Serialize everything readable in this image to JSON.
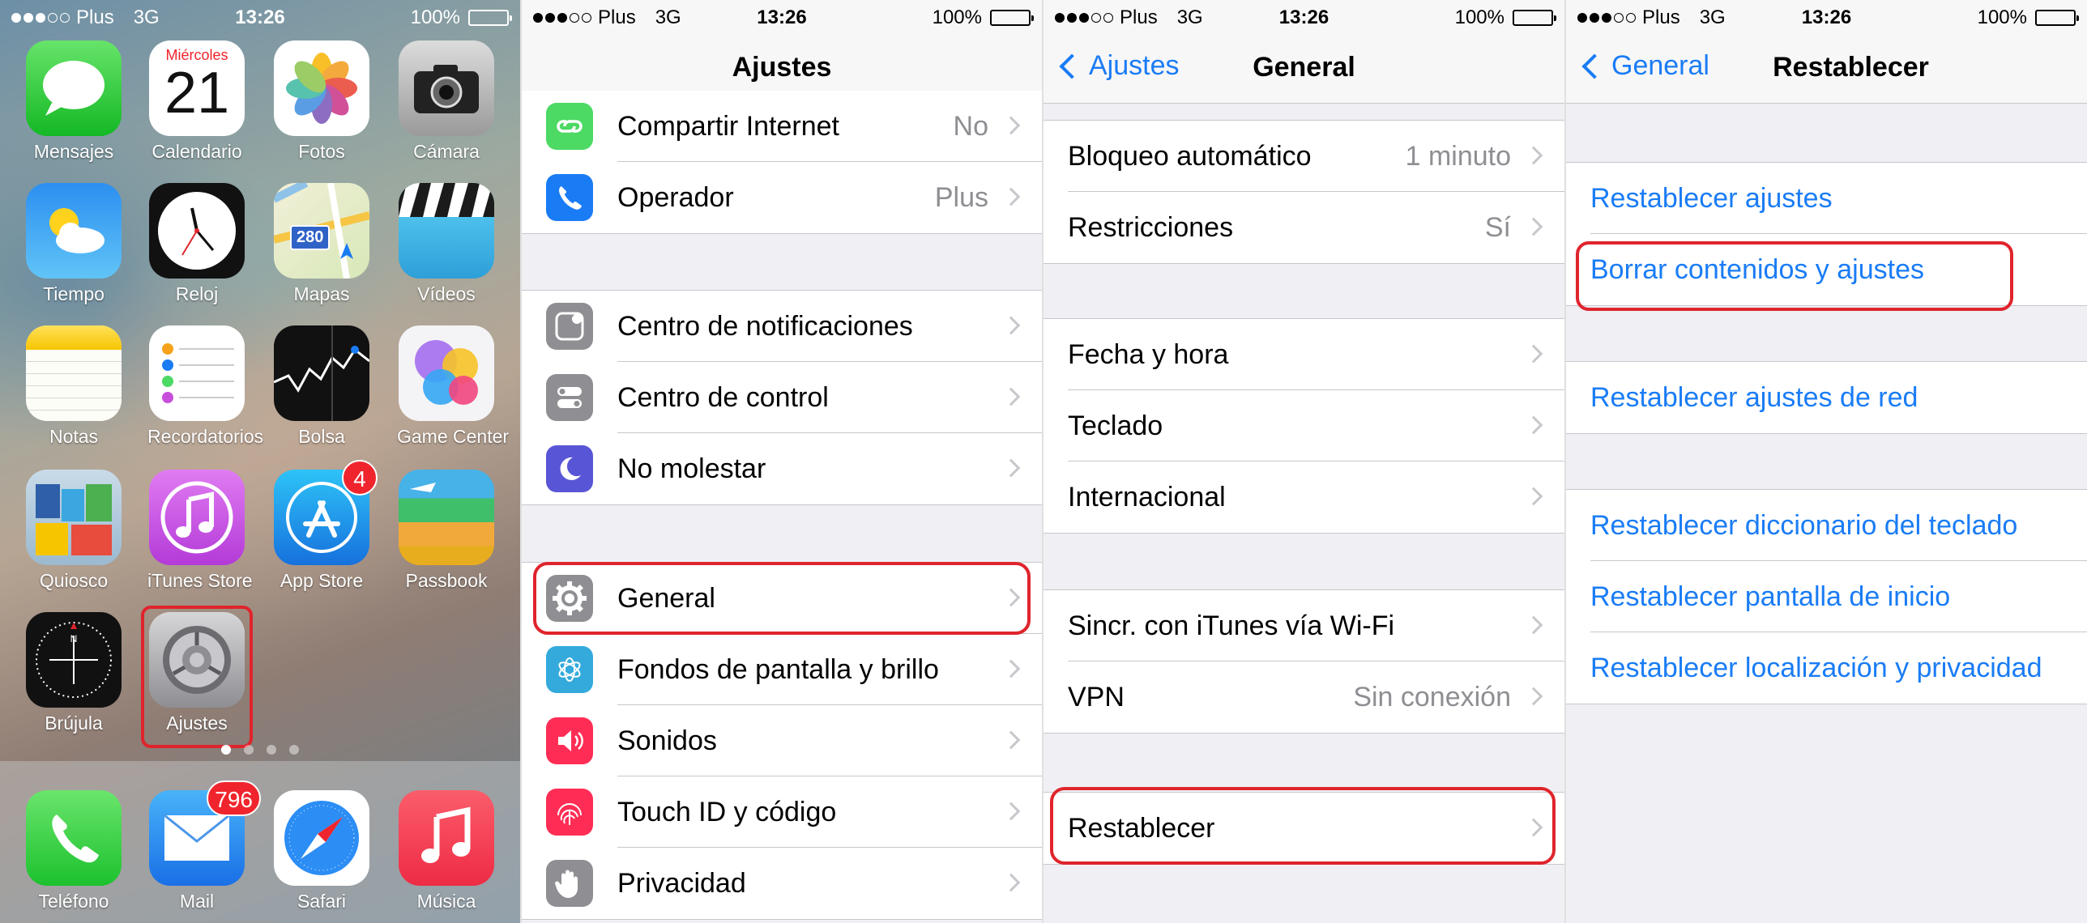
{
  "status": {
    "carrier": "Plus",
    "network": "3G",
    "time": "13:26",
    "battery": "100%"
  },
  "home": {
    "calendar": {
      "weekday": "Miércoles",
      "day": "21"
    },
    "apps": [
      {
        "label": "Mensajes",
        "icon": "messages-icon"
      },
      {
        "label": "Calendario",
        "icon": "calendar-icon"
      },
      {
        "label": "Fotos",
        "icon": "photos-icon"
      },
      {
        "label": "Cámara",
        "icon": "camera-icon"
      },
      {
        "label": "Tiempo",
        "icon": "weather-icon"
      },
      {
        "label": "Reloj",
        "icon": "clock-icon"
      },
      {
        "label": "Mapas",
        "icon": "maps-icon",
        "shield": "280"
      },
      {
        "label": "Vídeos",
        "icon": "videos-icon"
      },
      {
        "label": "Notas",
        "icon": "notes-icon"
      },
      {
        "label": "Recordatorios",
        "icon": "reminders-icon"
      },
      {
        "label": "Bolsa",
        "icon": "stocks-icon"
      },
      {
        "label": "Game Center",
        "icon": "game-center-icon"
      },
      {
        "label": "Quiosco",
        "icon": "newsstand-icon"
      },
      {
        "label": "iTunes Store",
        "icon": "itunes-store-icon"
      },
      {
        "label": "App Store",
        "icon": "app-store-icon",
        "badge": "4"
      },
      {
        "label": "Passbook",
        "icon": "passbook-icon"
      },
      {
        "label": "Brújula",
        "icon": "compass-icon"
      },
      {
        "label": "Ajustes",
        "icon": "settings-icon"
      }
    ],
    "dock": [
      {
        "label": "Teléfono",
        "icon": "phone-icon"
      },
      {
        "label": "Mail",
        "icon": "mail-icon",
        "badge": "796"
      },
      {
        "label": "Safari",
        "icon": "safari-icon"
      },
      {
        "label": "Música",
        "icon": "music-icon"
      }
    ]
  },
  "ajustes": {
    "title": "Ajustes",
    "groups": [
      [
        {
          "label": "Compartir Internet",
          "value": "No",
          "icon": "hotspot-icon"
        },
        {
          "label": "Operador",
          "value": "Plus",
          "icon": "carrier-phone-icon"
        }
      ],
      [
        {
          "label": "Centro de notificaciones",
          "icon": "notifications-icon"
        },
        {
          "label": "Centro de control",
          "icon": "control-center-icon"
        },
        {
          "label": "No molestar",
          "icon": "moon-icon"
        }
      ],
      [
        {
          "label": "General",
          "icon": "gear-icon"
        },
        {
          "label": "Fondos de pantalla y brillo",
          "icon": "wallpaper-icon"
        },
        {
          "label": "Sonidos",
          "icon": "sounds-icon"
        },
        {
          "label": "Touch ID y código",
          "icon": "fingerprint-icon"
        },
        {
          "label": "Privacidad",
          "icon": "hand-icon"
        }
      ]
    ]
  },
  "general": {
    "back": "Ajustes",
    "title": "General",
    "groups": [
      [
        {
          "label": "Bloqueo automático",
          "value": "1 minuto"
        },
        {
          "label": "Restricciones",
          "value": "Sí"
        }
      ],
      [
        {
          "label": "Fecha y hora"
        },
        {
          "label": "Teclado"
        },
        {
          "label": "Internacional"
        }
      ],
      [
        {
          "label": "Sincr. con iTunes vía Wi-Fi"
        },
        {
          "label": "VPN",
          "value": "Sin conexión"
        }
      ],
      [
        {
          "label": "Restablecer"
        }
      ]
    ]
  },
  "restablecer": {
    "back": "General",
    "title": "Restablecer",
    "groups": [
      [
        {
          "label": "Restablecer ajustes"
        },
        {
          "label": "Borrar contenidos y ajustes"
        }
      ],
      [
        {
          "label": "Restablecer ajustes de red"
        }
      ],
      [
        {
          "label": "Restablecer diccionario del teclado"
        },
        {
          "label": "Restablecer pantalla de inicio"
        },
        {
          "label": "Restablecer localización y privacidad"
        }
      ]
    ]
  },
  "colors": {
    "ios_blue": "#1a7cf5",
    "highlight_red": "#e0242c",
    "grouped_bg": "#efeff4"
  }
}
